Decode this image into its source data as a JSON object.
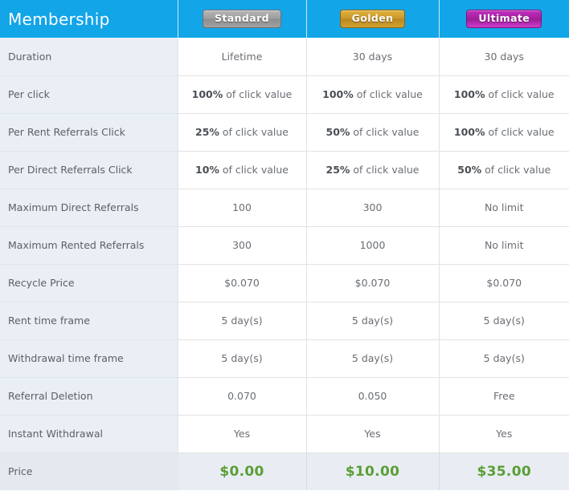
{
  "header": {
    "title": "Membership",
    "plans": [
      {
        "name": "Standard",
        "badge_style": "standard",
        "color": "#9d9d9d"
      },
      {
        "name": "Golden",
        "badge_style": "golden",
        "color": "#c9962a"
      },
      {
        "name": "Ultimate",
        "badge_style": "ultimate",
        "color": "#a41f9e"
      }
    ]
  },
  "colors": {
    "header_bar": "#12a5e8",
    "label_column": "#eaeff5",
    "price_row": "#e9edf3",
    "price_text": "#5a9e35"
  },
  "rows": [
    {
      "label": "Duration",
      "values": [
        "Lifetime",
        "30 days",
        "30 days"
      ],
      "emphasis": [
        "",
        "",
        ""
      ]
    },
    {
      "label": "Per click",
      "values": [
        "of click value",
        "of click value",
        "of click value"
      ],
      "emphasis": [
        "100%",
        "100%",
        "100%"
      ]
    },
    {
      "label": "Per Rent Referrals Click",
      "values": [
        "of click value",
        "of click value",
        "of click value"
      ],
      "emphasis": [
        "25%",
        "50%",
        "100%"
      ]
    },
    {
      "label": "Per Direct Referrals Click",
      "values": [
        "of click value",
        "of click value",
        "of click value"
      ],
      "emphasis": [
        "10%",
        "25%",
        "50%"
      ]
    },
    {
      "label": "Maximum Direct Referrals",
      "values": [
        "100",
        "300",
        "No limit"
      ],
      "emphasis": [
        "",
        "",
        ""
      ]
    },
    {
      "label": "Maximum Rented Referrals",
      "values": [
        "300",
        "1000",
        "No limit"
      ],
      "emphasis": [
        "",
        "",
        ""
      ]
    },
    {
      "label": "Recycle Price",
      "values": [
        "$0.070",
        "$0.070",
        "$0.070"
      ],
      "emphasis": [
        "",
        "",
        ""
      ]
    },
    {
      "label": "Rent time frame",
      "values": [
        "5 day(s)",
        "5 day(s)",
        "5 day(s)"
      ],
      "emphasis": [
        "",
        "",
        ""
      ]
    },
    {
      "label": "Withdrawal time frame",
      "values": [
        "5 day(s)",
        "5 day(s)",
        "5 day(s)"
      ],
      "emphasis": [
        "",
        "",
        ""
      ]
    },
    {
      "label": "Referral Deletion",
      "values": [
        "0.070",
        "0.050",
        "Free"
      ],
      "emphasis": [
        "",
        "",
        ""
      ]
    },
    {
      "label": "Instant Withdrawal",
      "values": [
        "Yes",
        "Yes",
        "Yes"
      ],
      "emphasis": [
        "",
        "",
        ""
      ]
    }
  ],
  "price_row": {
    "label": "Price",
    "values": [
      "$0.00",
      "$10.00",
      "$35.00"
    ]
  }
}
